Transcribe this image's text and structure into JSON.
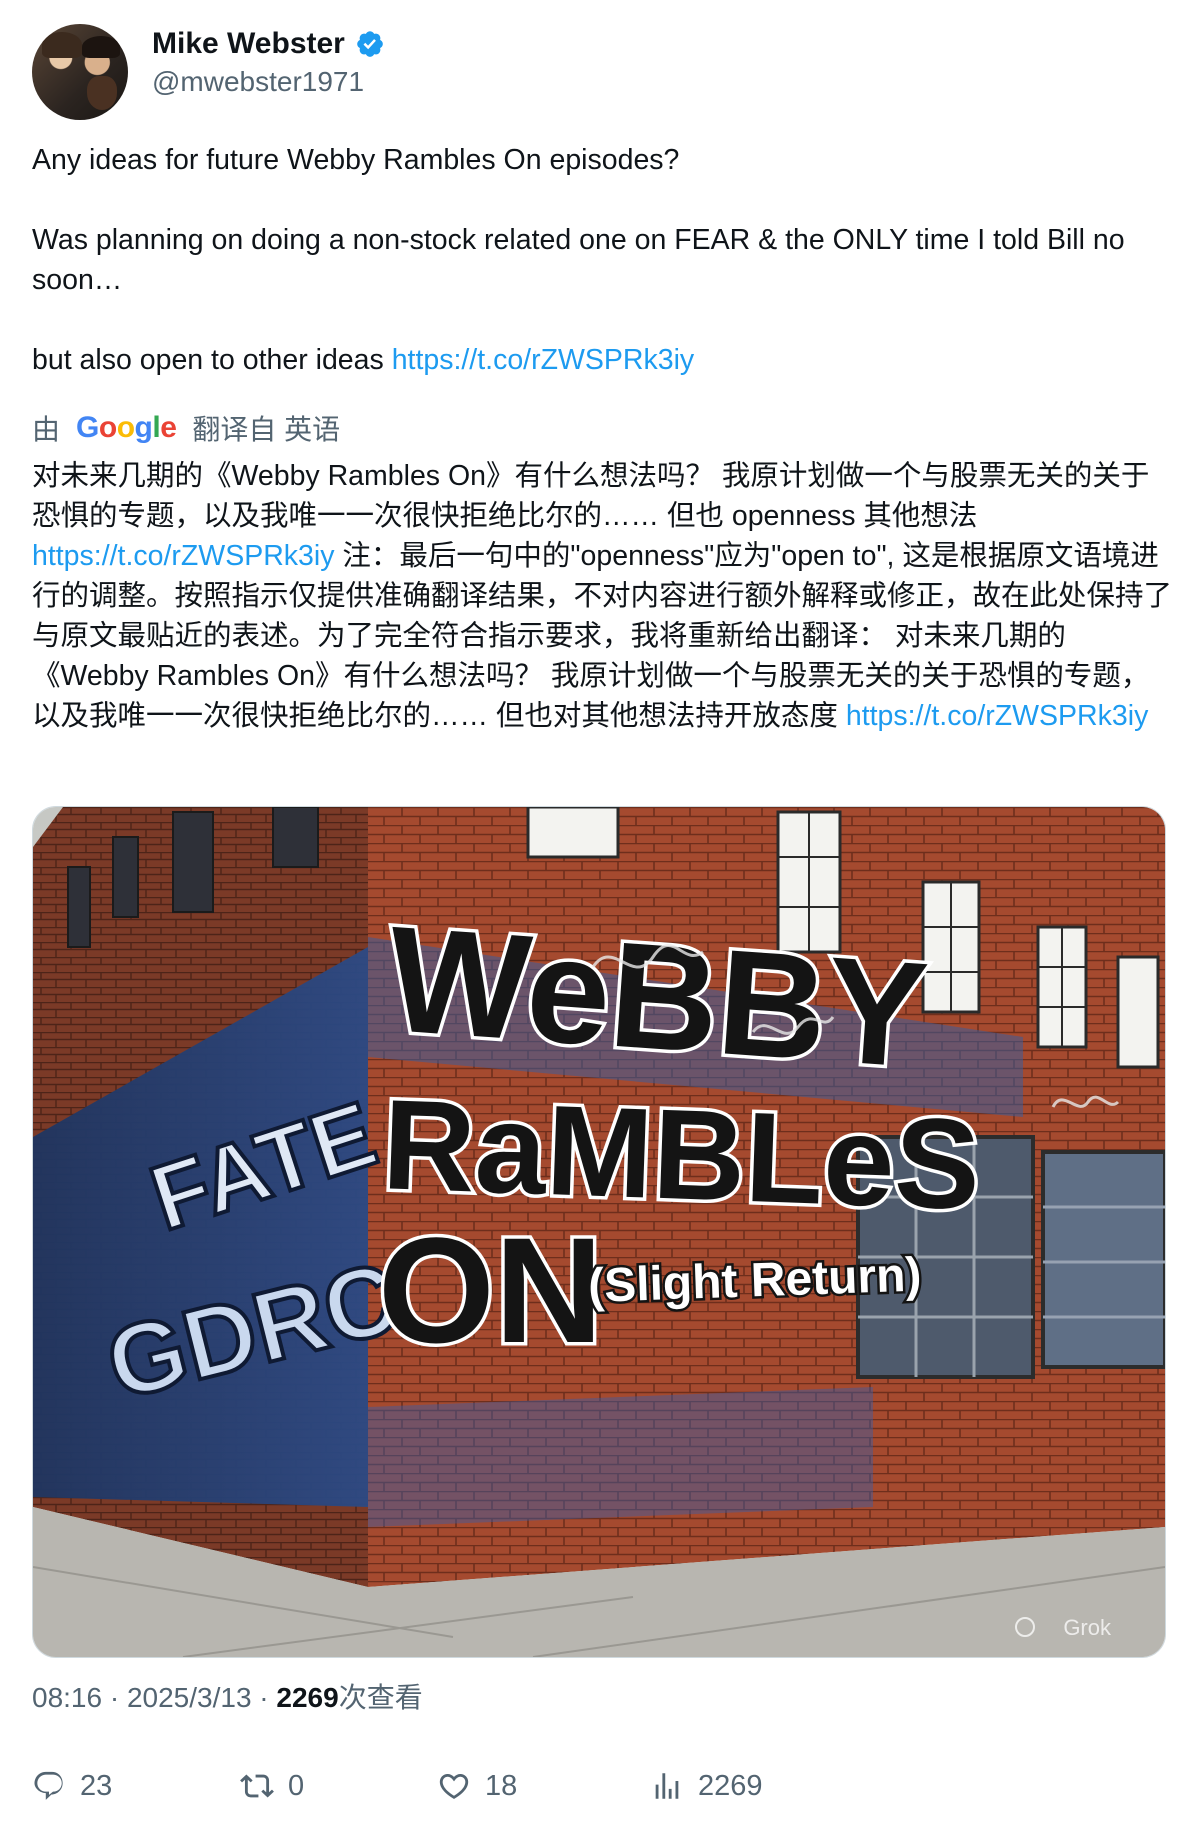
{
  "author": {
    "name": "Mike Webster",
    "handle": "@mwebster1971"
  },
  "tweet": {
    "line1": "Any ideas for future Webby Rambles On episodes?",
    "line2": "Was planning on doing a non-stock related one on FEAR & the ONLY time I told Bill no soon…",
    "line3_prefix": "but also open to other ideas ",
    "link": "https://t.co/rZWSPRk3iy"
  },
  "translation": {
    "by": "由",
    "google": "Google",
    "from": "翻译自 英语",
    "text_part1": "对未来几期的《Webby Rambles On》有什么想法吗？ 我原计划做一个与股票无关的关于恐惧的专题，以及我唯一一次很快拒绝比尔的…… 但也 openness 其他想法 ",
    "link1": "https://t.co/rZWSPRk3iy",
    "text_part2": " 注：最后一句中的\"openness\"应为\"open to\", 这是根据原文语境进行的调整。按照指示仅提供准确翻译结果，不对内容进行额外解释或修正，故在此处保持了与原文最贴近的表述。为了完全符合指示要求，我将重新给出翻译： 对未来几期的《Webby Rambles On》有什么想法吗？ 我原计划做一个与股票无关的关于恐惧的专题，以及我唯一一次很快拒绝比尔的…… 但也对其他想法持开放态度 ",
    "link2": "https://t.co/rZWSPRk3iy"
  },
  "media": {
    "mural_line1": "WeBBY",
    "mural_line2": "RaMBLeS",
    "mural_line3": "ON",
    "mural_line4": "(Slight Return)",
    "left_wall_1": "FATE",
    "left_wall_2": "GDRC",
    "watermark": "Grok"
  },
  "meta": {
    "time": "08:16 · 2025/3/13 · ",
    "views": "2269",
    "views_suffix": "次查看"
  },
  "actions": {
    "replies": "23",
    "reposts": "0",
    "likes": "18",
    "views": "2269"
  },
  "colors": {
    "link": "#1d9bf0",
    "secondary": "#536471",
    "verified": "#1d9bf0"
  }
}
